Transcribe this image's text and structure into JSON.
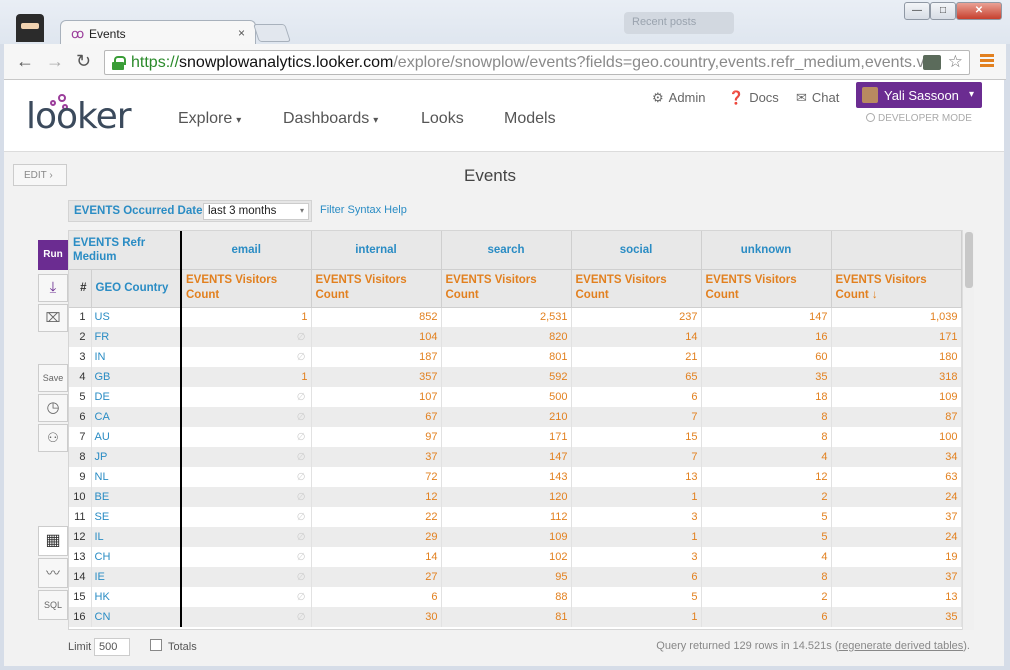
{
  "browser": {
    "tab_title": "Events",
    "tab_close": "×",
    "ghost_tab": "Recent posts",
    "window_min": "—",
    "window_max": "□",
    "window_close": "✕",
    "url_scheme": "https://",
    "url_host": "snowplowanalytics.looker.com",
    "url_path": "/explore/snowplow/events?fields=geo.country,events.refr_medium,events.vi",
    "back_icon": "←",
    "forward_icon": "→",
    "reload_icon": "↻",
    "star_icon": "☆"
  },
  "header": {
    "logo": "looker",
    "nav": [
      {
        "label": "Explore",
        "caret": "▾"
      },
      {
        "label": "Dashboards",
        "caret": "▾"
      },
      {
        "label": "Looks"
      },
      {
        "label": "Models"
      }
    ],
    "admin": "Admin",
    "docs": "Docs",
    "chat": "Chat",
    "user": "Yali Sassoon",
    "user_caret": "▾",
    "dev_mode": "DEVELOPER MODE"
  },
  "page": {
    "edit": "EDIT ›",
    "title": "Events"
  },
  "filter": {
    "label": "EVENTS Occurred Date",
    "value": "last 3 months",
    "caret": "▾",
    "help": "Filter Syntax Help"
  },
  "sidebar": {
    "run": "Run",
    "save": "Save",
    "sql": "SQL"
  },
  "table": {
    "pivot_label": "EVENTS Refr Medium",
    "pivots": [
      "email",
      "internal",
      "search",
      "social",
      "unknown",
      ""
    ],
    "hash": "#",
    "dimension": "GEO Country",
    "measure": "EVENTS Visitors Count",
    "sort_arrow": "↓",
    "null_symbol": "∅",
    "rows": [
      {
        "n": "1",
        "country": "US",
        "v": [
          "1",
          "852",
          "2,531",
          "237",
          "147",
          "1,039"
        ]
      },
      {
        "n": "2",
        "country": "FR",
        "v": [
          null,
          "104",
          "820",
          "14",
          "16",
          "171"
        ]
      },
      {
        "n": "3",
        "country": "IN",
        "v": [
          null,
          "187",
          "801",
          "21",
          "60",
          "180"
        ]
      },
      {
        "n": "4",
        "country": "GB",
        "v": [
          "1",
          "357",
          "592",
          "65",
          "35",
          "318"
        ]
      },
      {
        "n": "5",
        "country": "DE",
        "v": [
          null,
          "107",
          "500",
          "6",
          "18",
          "109"
        ]
      },
      {
        "n": "6",
        "country": "CA",
        "v": [
          null,
          "67",
          "210",
          "7",
          "8",
          "87"
        ]
      },
      {
        "n": "7",
        "country": "AU",
        "v": [
          null,
          "97",
          "171",
          "15",
          "8",
          "100"
        ]
      },
      {
        "n": "8",
        "country": "JP",
        "v": [
          null,
          "37",
          "147",
          "7",
          "4",
          "34"
        ]
      },
      {
        "n": "9",
        "country": "NL",
        "v": [
          null,
          "72",
          "143",
          "13",
          "12",
          "63"
        ]
      },
      {
        "n": "10",
        "country": "BE",
        "v": [
          null,
          "12",
          "120",
          "1",
          "2",
          "24"
        ]
      },
      {
        "n": "11",
        "country": "SE",
        "v": [
          null,
          "22",
          "112",
          "3",
          "5",
          "37"
        ]
      },
      {
        "n": "12",
        "country": "IL",
        "v": [
          null,
          "29",
          "109",
          "1",
          "5",
          "24"
        ]
      },
      {
        "n": "13",
        "country": "CH",
        "v": [
          null,
          "14",
          "102",
          "3",
          "4",
          "19"
        ]
      },
      {
        "n": "14",
        "country": "IE",
        "v": [
          null,
          "27",
          "95",
          "6",
          "8",
          "37"
        ]
      },
      {
        "n": "15",
        "country": "HK",
        "v": [
          null,
          "6",
          "88",
          "5",
          "2",
          "13"
        ]
      },
      {
        "n": "16",
        "country": "CN",
        "v": [
          null,
          "30",
          "81",
          "1",
          "6",
          "35"
        ]
      }
    ]
  },
  "footer": {
    "limit_label": "Limit",
    "limit_value": "500",
    "totals": "Totals",
    "query_prefix": "Query returned 129 rows in 14.521s (",
    "query_link": "regenerate derived tables",
    "query_suffix": ")."
  }
}
